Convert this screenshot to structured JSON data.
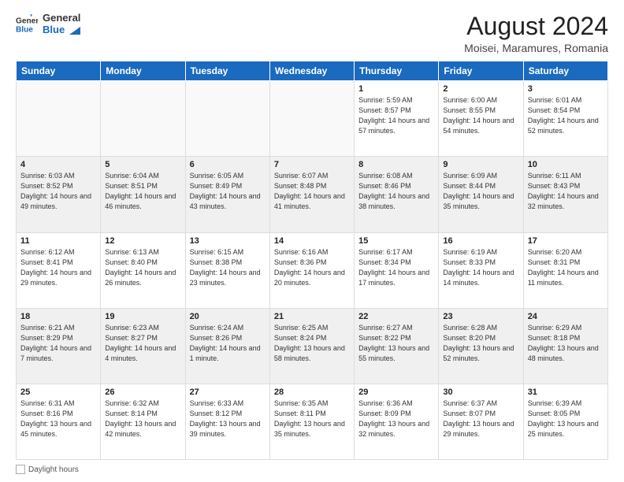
{
  "logo": {
    "general": "General",
    "blue": "Blue"
  },
  "header": {
    "title": "August 2024",
    "subtitle": "Moisei, Maramures, Romania"
  },
  "days": [
    "Sunday",
    "Monday",
    "Tuesday",
    "Wednesday",
    "Thursday",
    "Friday",
    "Saturday"
  ],
  "weeks": [
    [
      {
        "day": "",
        "info": ""
      },
      {
        "day": "",
        "info": ""
      },
      {
        "day": "",
        "info": ""
      },
      {
        "day": "",
        "info": ""
      },
      {
        "day": "1",
        "info": "Sunrise: 5:59 AM\nSunset: 8:57 PM\nDaylight: 14 hours and 57 minutes."
      },
      {
        "day": "2",
        "info": "Sunrise: 6:00 AM\nSunset: 8:55 PM\nDaylight: 14 hours and 54 minutes."
      },
      {
        "day": "3",
        "info": "Sunrise: 6:01 AM\nSunset: 8:54 PM\nDaylight: 14 hours and 52 minutes."
      }
    ],
    [
      {
        "day": "4",
        "info": "Sunrise: 6:03 AM\nSunset: 8:52 PM\nDaylight: 14 hours and 49 minutes."
      },
      {
        "day": "5",
        "info": "Sunrise: 6:04 AM\nSunset: 8:51 PM\nDaylight: 14 hours and 46 minutes."
      },
      {
        "day": "6",
        "info": "Sunrise: 6:05 AM\nSunset: 8:49 PM\nDaylight: 14 hours and 43 minutes."
      },
      {
        "day": "7",
        "info": "Sunrise: 6:07 AM\nSunset: 8:48 PM\nDaylight: 14 hours and 41 minutes."
      },
      {
        "day": "8",
        "info": "Sunrise: 6:08 AM\nSunset: 8:46 PM\nDaylight: 14 hours and 38 minutes."
      },
      {
        "day": "9",
        "info": "Sunrise: 6:09 AM\nSunset: 8:44 PM\nDaylight: 14 hours and 35 minutes."
      },
      {
        "day": "10",
        "info": "Sunrise: 6:11 AM\nSunset: 8:43 PM\nDaylight: 14 hours and 32 minutes."
      }
    ],
    [
      {
        "day": "11",
        "info": "Sunrise: 6:12 AM\nSunset: 8:41 PM\nDaylight: 14 hours and 29 minutes."
      },
      {
        "day": "12",
        "info": "Sunrise: 6:13 AM\nSunset: 8:40 PM\nDaylight: 14 hours and 26 minutes."
      },
      {
        "day": "13",
        "info": "Sunrise: 6:15 AM\nSunset: 8:38 PM\nDaylight: 14 hours and 23 minutes."
      },
      {
        "day": "14",
        "info": "Sunrise: 6:16 AM\nSunset: 8:36 PM\nDaylight: 14 hours and 20 minutes."
      },
      {
        "day": "15",
        "info": "Sunrise: 6:17 AM\nSunset: 8:34 PM\nDaylight: 14 hours and 17 minutes."
      },
      {
        "day": "16",
        "info": "Sunrise: 6:19 AM\nSunset: 8:33 PM\nDaylight: 14 hours and 14 minutes."
      },
      {
        "day": "17",
        "info": "Sunrise: 6:20 AM\nSunset: 8:31 PM\nDaylight: 14 hours and 11 minutes."
      }
    ],
    [
      {
        "day": "18",
        "info": "Sunrise: 6:21 AM\nSunset: 8:29 PM\nDaylight: 14 hours and 7 minutes."
      },
      {
        "day": "19",
        "info": "Sunrise: 6:23 AM\nSunset: 8:27 PM\nDaylight: 14 hours and 4 minutes."
      },
      {
        "day": "20",
        "info": "Sunrise: 6:24 AM\nSunset: 8:26 PM\nDaylight: 14 hours and 1 minute."
      },
      {
        "day": "21",
        "info": "Sunrise: 6:25 AM\nSunset: 8:24 PM\nDaylight: 13 hours and 58 minutes."
      },
      {
        "day": "22",
        "info": "Sunrise: 6:27 AM\nSunset: 8:22 PM\nDaylight: 13 hours and 55 minutes."
      },
      {
        "day": "23",
        "info": "Sunrise: 6:28 AM\nSunset: 8:20 PM\nDaylight: 13 hours and 52 minutes."
      },
      {
        "day": "24",
        "info": "Sunrise: 6:29 AM\nSunset: 8:18 PM\nDaylight: 13 hours and 48 minutes."
      }
    ],
    [
      {
        "day": "25",
        "info": "Sunrise: 6:31 AM\nSunset: 8:16 PM\nDaylight: 13 hours and 45 minutes."
      },
      {
        "day": "26",
        "info": "Sunrise: 6:32 AM\nSunset: 8:14 PM\nDaylight: 13 hours and 42 minutes."
      },
      {
        "day": "27",
        "info": "Sunrise: 6:33 AM\nSunset: 8:12 PM\nDaylight: 13 hours and 39 minutes."
      },
      {
        "day": "28",
        "info": "Sunrise: 6:35 AM\nSunset: 8:11 PM\nDaylight: 13 hours and 35 minutes."
      },
      {
        "day": "29",
        "info": "Sunrise: 6:36 AM\nSunset: 8:09 PM\nDaylight: 13 hours and 32 minutes."
      },
      {
        "day": "30",
        "info": "Sunrise: 6:37 AM\nSunset: 8:07 PM\nDaylight: 13 hours and 29 minutes."
      },
      {
        "day": "31",
        "info": "Sunrise: 6:39 AM\nSunset: 8:05 PM\nDaylight: 13 hours and 25 minutes."
      }
    ]
  ],
  "footer": {
    "daylight_label": "Daylight hours"
  }
}
